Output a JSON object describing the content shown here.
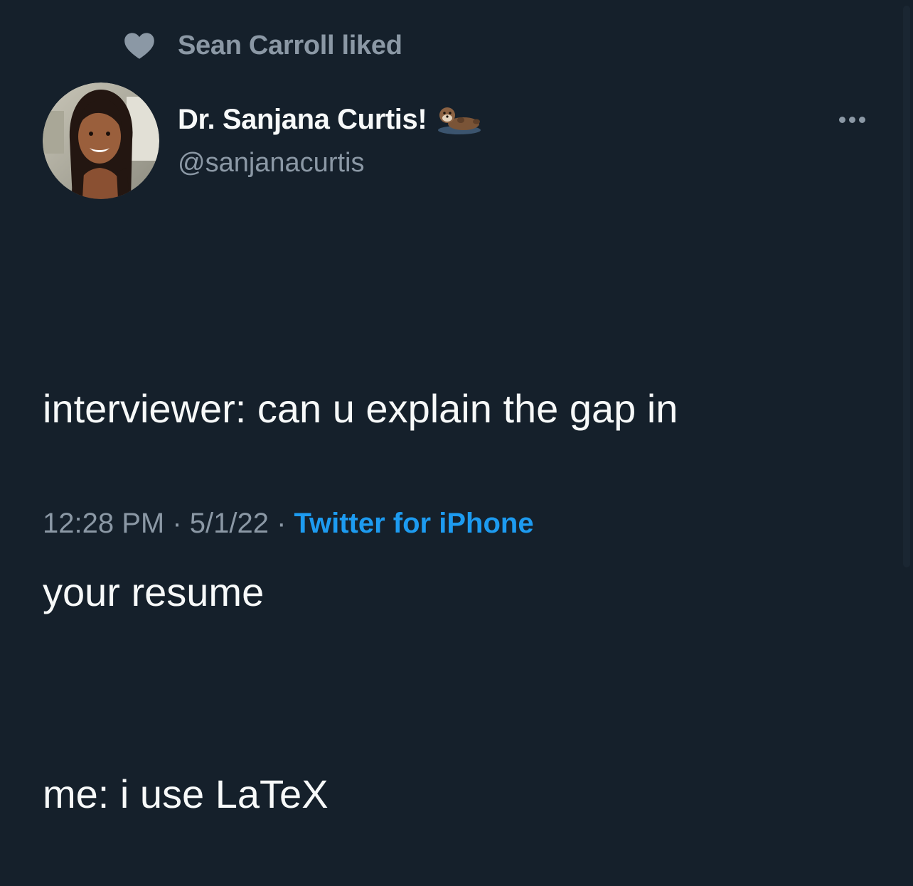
{
  "social_context": {
    "text": "Sean Carroll liked",
    "icon": "heart-icon"
  },
  "author": {
    "name": "Dr. Sanjana Curtis!",
    "name_emoji": "otter-icon",
    "handle": "@sanjanacurtis",
    "avatar": "profile-photo"
  },
  "tweet": {
    "line1": "interviewer: can u explain the gap in",
    "line2": "your resume",
    "line3": "me: i use LaTeX"
  },
  "meta": {
    "time": "12:28 PM",
    "sep1": " · ",
    "date": "5/1/22",
    "sep2": " · ",
    "source": "Twitter for iPhone"
  },
  "colors": {
    "background": "#15202b",
    "primary_text": "#f7f9f9",
    "secondary_text": "#8b98a5",
    "link": "#1d9bf0"
  }
}
